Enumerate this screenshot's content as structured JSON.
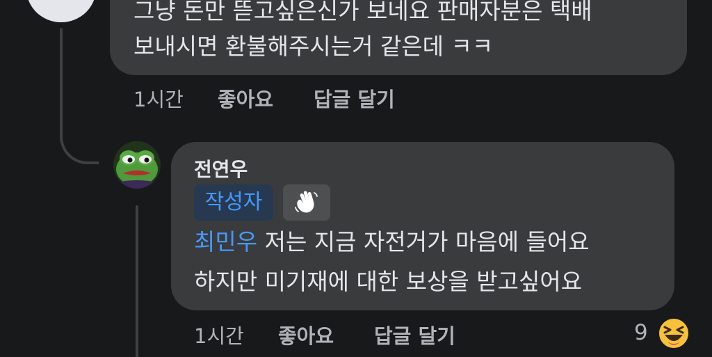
{
  "comment_top": {
    "line1": "그냥 돈만 뜯고싶은신가 보네요 판매자분은 택배",
    "line2": "보내시면 환불해주시는거 같은데 ㅋㅋ",
    "actions": {
      "time": "1시간",
      "like": "좋아요",
      "reply": "답글 달기"
    }
  },
  "reply": {
    "author": "전연우",
    "author_badge": "작성자",
    "wave_icon": "waving-hand-icon",
    "mention": "최민우",
    "line1_rest": " 저는 지금 자전거가 마음에 들어요",
    "line2": "하지만 미기재에 대한 보상을 받고싶어요",
    "actions": {
      "time": "1시간",
      "like": "좋아요",
      "reply": "답글 달기"
    },
    "reaction": {
      "count": "9",
      "emoji": "laughing-emoji-icon"
    }
  },
  "colors": {
    "background": "#18191a",
    "bubble": "#3a3b3c",
    "link_blue": "#4599ff",
    "badge_bg": "#263951",
    "muted_text": "#b0b3b8",
    "reaction_yellow": "#f7c23a"
  }
}
